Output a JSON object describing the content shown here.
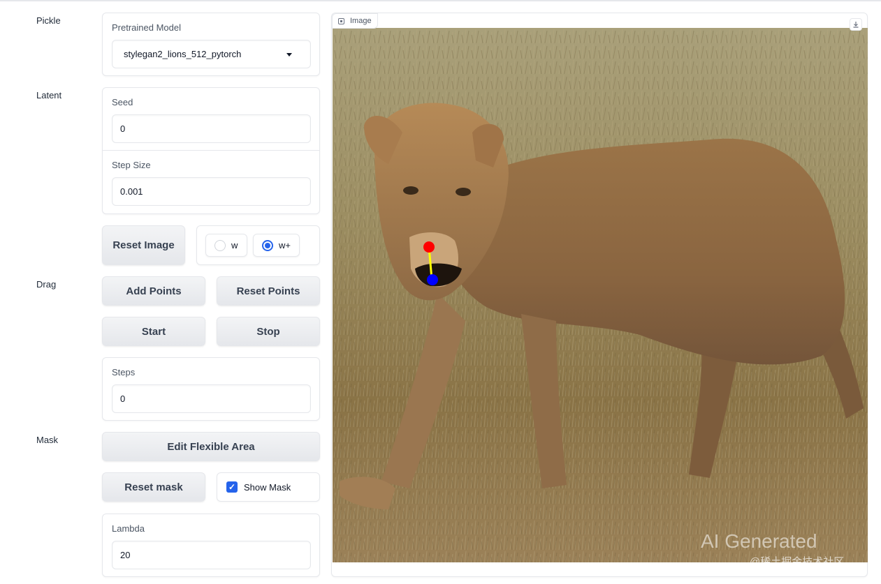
{
  "sections": {
    "pickle": "Pickle",
    "latent": "Latent",
    "drag": "Drag",
    "mask": "Mask"
  },
  "pickle": {
    "model_label": "Pretrained Model",
    "model_value": "stylegan2_lions_512_pytorch"
  },
  "latent": {
    "seed_label": "Seed",
    "seed_value": "0",
    "step_label": "Step Size",
    "step_value": "0.001",
    "reset_image": "Reset Image",
    "radio_w": "w",
    "radio_wplus": "w+",
    "selected": "w+"
  },
  "drag": {
    "add_points": "Add Points",
    "reset_points": "Reset Points",
    "start": "Start",
    "stop": "Stop",
    "steps_label": "Steps",
    "steps_value": "0"
  },
  "mask": {
    "edit_area": "Edit Flexible Area",
    "reset_mask": "Reset mask",
    "show_mask": "Show Mask",
    "show_mask_checked": true,
    "lambda_label": "Lambda",
    "lambda_value": "20"
  },
  "image": {
    "tab_label": "Image",
    "handle_color": "#ff0000",
    "target_color": "#0000ff",
    "line_color": "#ffff00",
    "watermark_line1": "AI Generated",
    "watermark_line2": "@稀土掘金技术社区"
  }
}
